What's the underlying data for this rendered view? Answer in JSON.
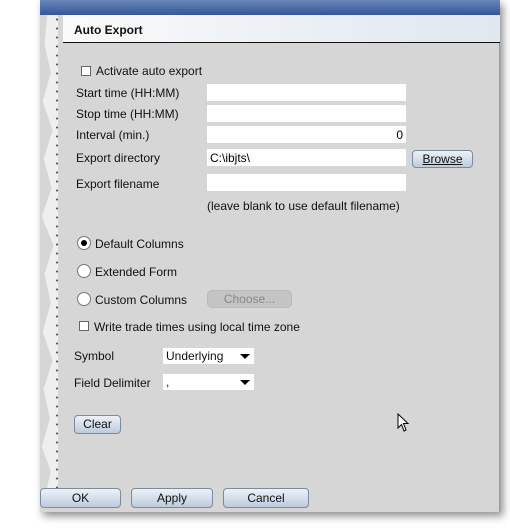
{
  "header": {
    "title": "Auto Export"
  },
  "activate": {
    "label": "Activate auto export",
    "checked": false
  },
  "fields": {
    "start_time": {
      "label": "Start time (HH:MM)",
      "value": ""
    },
    "stop_time": {
      "label": "Stop time (HH:MM)",
      "value": ""
    },
    "interval": {
      "label": "Interval (min.)",
      "value": "0"
    },
    "export_directory": {
      "label": "Export directory",
      "value": "C:\\ibjts\\"
    },
    "export_filename": {
      "label": "Export filename",
      "value": ""
    },
    "filename_hint": "(leave blank to use default filename)"
  },
  "browse_label": "Browse",
  "columns": {
    "options": [
      "Default Columns",
      "Extended Form",
      "Custom Columns"
    ],
    "selected": "Default Columns",
    "choose_label": "Choose..."
  },
  "local_time": {
    "label": "Write trade times using local time zone",
    "checked": false
  },
  "symbol": {
    "label": "Symbol",
    "value": "Underlying"
  },
  "delimiter": {
    "label": "Field Delimiter",
    "value": ","
  },
  "clear_label": "Clear",
  "footer": {
    "ok": "OK",
    "apply": "Apply",
    "cancel": "Cancel"
  }
}
